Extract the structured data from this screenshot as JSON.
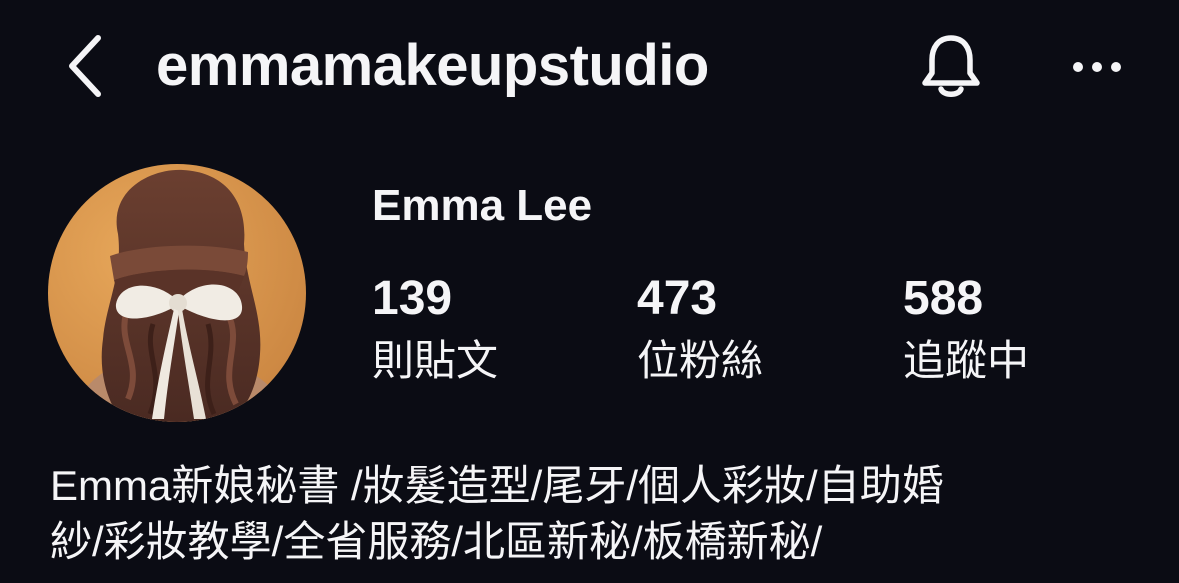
{
  "header": {
    "username": "emmamakeupstudio",
    "back_icon": "chevron-left-icon",
    "bell_icon": "bell-icon",
    "more_icon": "more-horizontal-icon"
  },
  "profile": {
    "display_name": "Emma Lee",
    "avatar": "profile-photo"
  },
  "stats": [
    {
      "count": "139",
      "label": "則貼文"
    },
    {
      "count": "473",
      "label": "位粉絲"
    },
    {
      "count": "588",
      "label": "追蹤中"
    }
  ],
  "bio": {
    "lines": [
      "Emma新娘秘書 /妝髮造型/尾牙/個人彩妝/自助婚",
      "紗/彩妝教學/全省服務/北區新秘/板橋新秘/"
    ]
  },
  "colors": {
    "background": "#0b0c14",
    "text": "#f5f5f7"
  }
}
